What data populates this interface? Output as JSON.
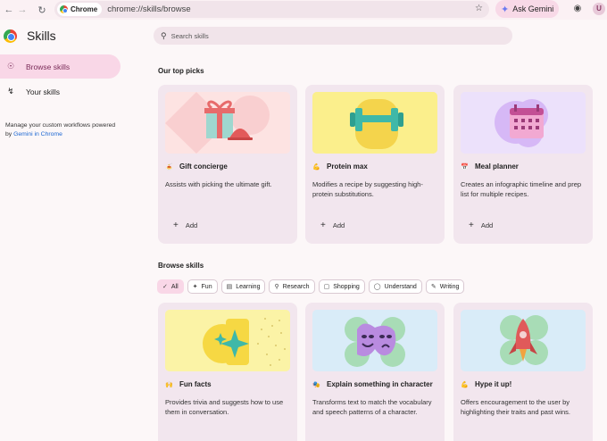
{
  "browser": {
    "chip_label": "Chrome",
    "url": "chrome://skills/browse",
    "ask_gemini": "Ask Gemini",
    "avatar_letter": "U"
  },
  "sidebar": {
    "title": "Skills",
    "items": [
      {
        "label": "Browse skills",
        "icon": "compass-icon",
        "active": true
      },
      {
        "label": "Your skills",
        "icon": "bolt-icon",
        "active": false
      }
    ],
    "note_text": "Manage your custom workflows powered by",
    "note_link": "Gemini in Chrome"
  },
  "search": {
    "placeholder": "Search skills"
  },
  "top_picks": {
    "title": "Our top picks",
    "cards": [
      {
        "emoji": "🍝",
        "title": "Gift concierge",
        "desc": "Assists with picking the ultimate gift.",
        "add": "Add"
      },
      {
        "emoji": "💪",
        "title": "Protein max",
        "desc": "Modifies a recipe by suggesting high-protein substitutions.",
        "add": "Add"
      },
      {
        "emoji": "📅",
        "title": "Meal planner",
        "desc": "Creates an infographic timeline and prep list for multiple recipes.",
        "add": "Add"
      }
    ]
  },
  "browse": {
    "title": "Browse skills",
    "filters": [
      {
        "label": "All",
        "icon": "check-icon",
        "active": true
      },
      {
        "label": "Fun",
        "icon": "sparkle-icon",
        "active": false
      },
      {
        "label": "Learning",
        "icon": "book-icon",
        "active": false
      },
      {
        "label": "Research",
        "icon": "search-icon",
        "active": false
      },
      {
        "label": "Shopping",
        "icon": "bag-icon",
        "active": false
      },
      {
        "label": "Understand",
        "icon": "bulb-icon",
        "active": false
      },
      {
        "label": "Writing",
        "icon": "pen-icon",
        "active": false
      }
    ],
    "cards": [
      {
        "emoji": "🙌",
        "title": "Fun facts",
        "desc": "Provides trivia and suggests how to use them in conversation."
      },
      {
        "emoji": "🎭",
        "title": "Explain something in character",
        "desc": "Transforms text to match the vocabulary and speech patterns of a character."
      },
      {
        "emoji": "💪",
        "title": "Hype it up!",
        "desc": "Offers encouragement to the user by highlighting their traits and past wins."
      }
    ]
  }
}
